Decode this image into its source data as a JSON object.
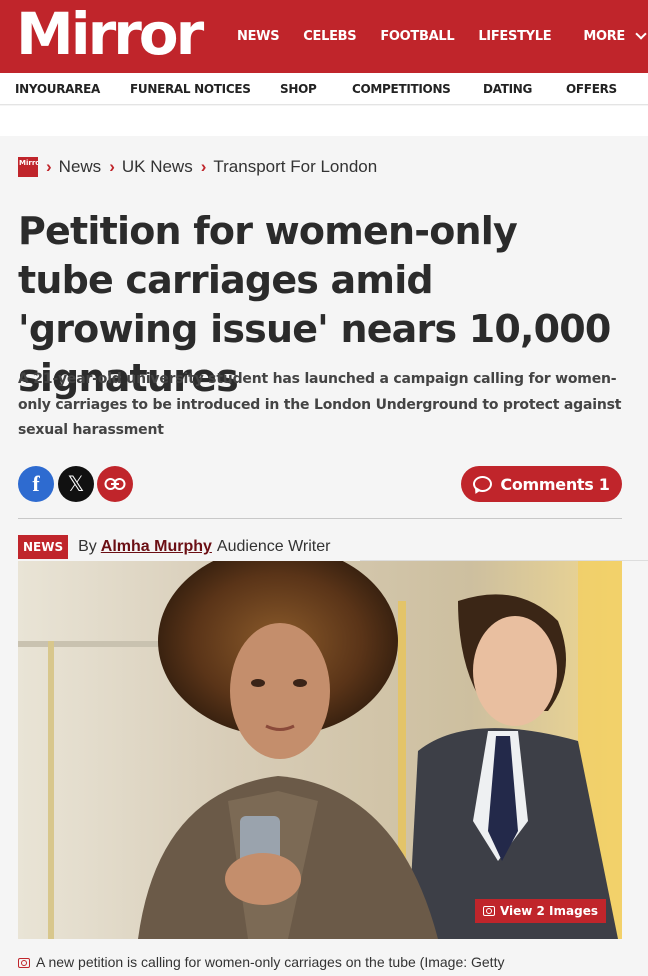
{
  "brand": {
    "logo_text": "Mirror",
    "accent_color": "#c0252b"
  },
  "main_nav": {
    "items": [
      "NEWS",
      "CELEBS",
      "FOOTBALL",
      "LIFESTYLE"
    ],
    "more_label": "MORE"
  },
  "sub_nav": {
    "items": [
      "INYOURAREA",
      "FUNERAL NOTICES",
      "SHOP",
      "COMPETITIONS",
      "DATING",
      "OFFERS"
    ]
  },
  "breadcrumb": {
    "logo_text": "Mirror",
    "items": [
      "News",
      "UK News",
      "Transport For London"
    ]
  },
  "article": {
    "headline": "Petition for women-only tube carriages amid 'growing issue' nears 10,000 signatures",
    "standfirst": "A 21-year-old university student has launched a campaign calling for women-only carriages to be introduced in the London Underground to protect against sexual harassment",
    "share": {
      "facebook_icon": "f",
      "x_icon": "𝕏",
      "link_icon": "link-icon"
    },
    "comments_label": "Comments 1",
    "byline": {
      "badge": "NEWS",
      "by": "By",
      "author": "Almha Murphy",
      "role": "Audience Writer"
    },
    "hero": {
      "view_images_label": "View 2 Images"
    },
    "caption": "A new petition is calling for women-only carriages on the tube (Image: Getty Images/iStockphoto)"
  }
}
